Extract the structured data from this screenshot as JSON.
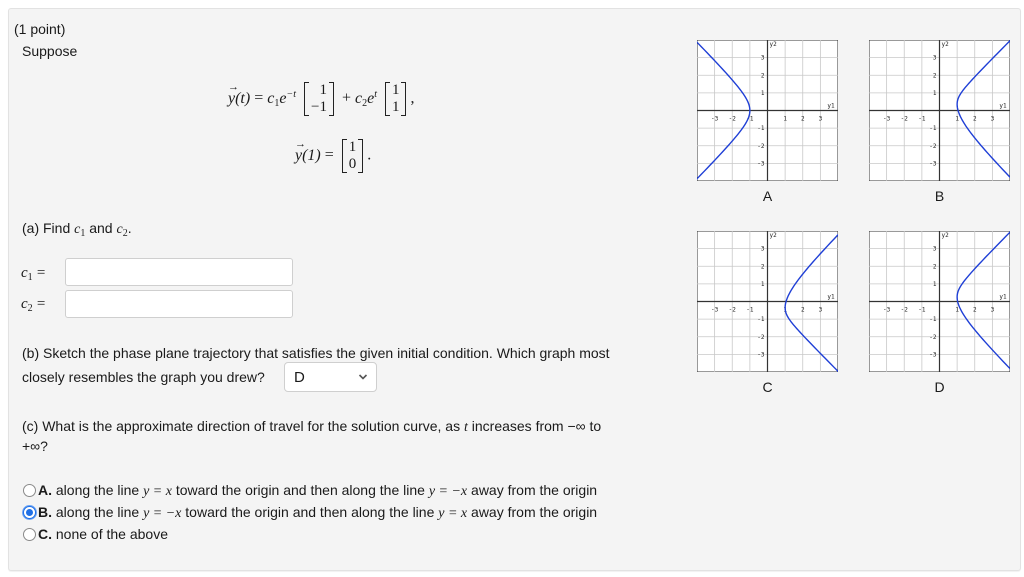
{
  "problem": {
    "points": "(1 point)",
    "intro": "Suppose",
    "equation": {
      "lhs": "y(t)",
      "equals": "=",
      "c1": "c",
      "c1_sub": "1",
      "exp1": "e",
      "exp1_sup": "−t",
      "vec1": [
        "1",
        "−1"
      ],
      "plus": "+",
      "c2": "c",
      "c2_sub": "2",
      "exp2": "e",
      "exp2_sup": "t",
      "vec2": [
        "1",
        "1"
      ],
      "comma": ","
    },
    "initial_condition": {
      "lhs": "y(1)",
      "equals": "=",
      "vec": [
        "1",
        "0"
      ],
      "period": "."
    }
  },
  "part_a": {
    "prompt_prefix": "(a) Find ",
    "c1": "c",
    "c1_sub": "1",
    "and": " and ",
    "c2": "c",
    "c2_sub": "2",
    "period": ".",
    "fields": [
      {
        "label": "c",
        "label_sub": "1",
        "equals": "=",
        "value": "",
        "placeholder": ""
      },
      {
        "label": "c",
        "label_sub": "2",
        "equals": "=",
        "value": "",
        "placeholder": ""
      }
    ]
  },
  "part_b": {
    "line1": "(b) Sketch the phase plane trajectory that satisfies the given initial condition. Which graph most",
    "line2": "closely resembles the graph you drew?",
    "selected": "D"
  },
  "part_c": {
    "line1_prefix": "(c) What is the approximate direction of travel for the solution curve, as ",
    "line1_var": "t",
    "line1_suffix": " increases from −∞ to",
    "line2": "+∞?",
    "options": [
      {
        "key": "A.",
        "text_1": " along the line ",
        "math_1": "y = x",
        "text_2": " toward the origin and then along the line ",
        "math_2": "y = −x",
        "text_3": " away from the origin",
        "checked": false
      },
      {
        "key": "B.",
        "text_1": " along the line ",
        "math_1": "y = −x",
        "text_2": " toward the origin and then along the line ",
        "math_2": "y = x",
        "text_3": " away from the origin",
        "checked": true
      },
      {
        "key": "C.",
        "text_1": " none of the above",
        "math_1": "",
        "text_2": "",
        "math_2": "",
        "text_3": "",
        "checked": false
      }
    ]
  },
  "graphs": {
    "curve_color": "#1f3fd6",
    "axis_labels": {
      "x": "y1",
      "y": "y2"
    },
    "ticks": [
      "-3",
      "-2",
      "-1",
      "1",
      "2",
      "3"
    ],
    "y_ticks": [
      "3",
      "2",
      "1",
      "-1",
      "-2",
      "-3"
    ],
    "range": [
      -4,
      4
    ],
    "items": [
      {
        "label": "A",
        "branch": "left",
        "vertex_y1": -1
      },
      {
        "label": "B",
        "branch": "right",
        "vertex_y1": 1,
        "shift": 0.35
      },
      {
        "label": "C",
        "branch": "right",
        "vertex_y1": 1,
        "shift": -0.35
      },
      {
        "label": "D",
        "branch": "right",
        "vertex_y1": 1,
        "shift": 0.25
      }
    ]
  }
}
